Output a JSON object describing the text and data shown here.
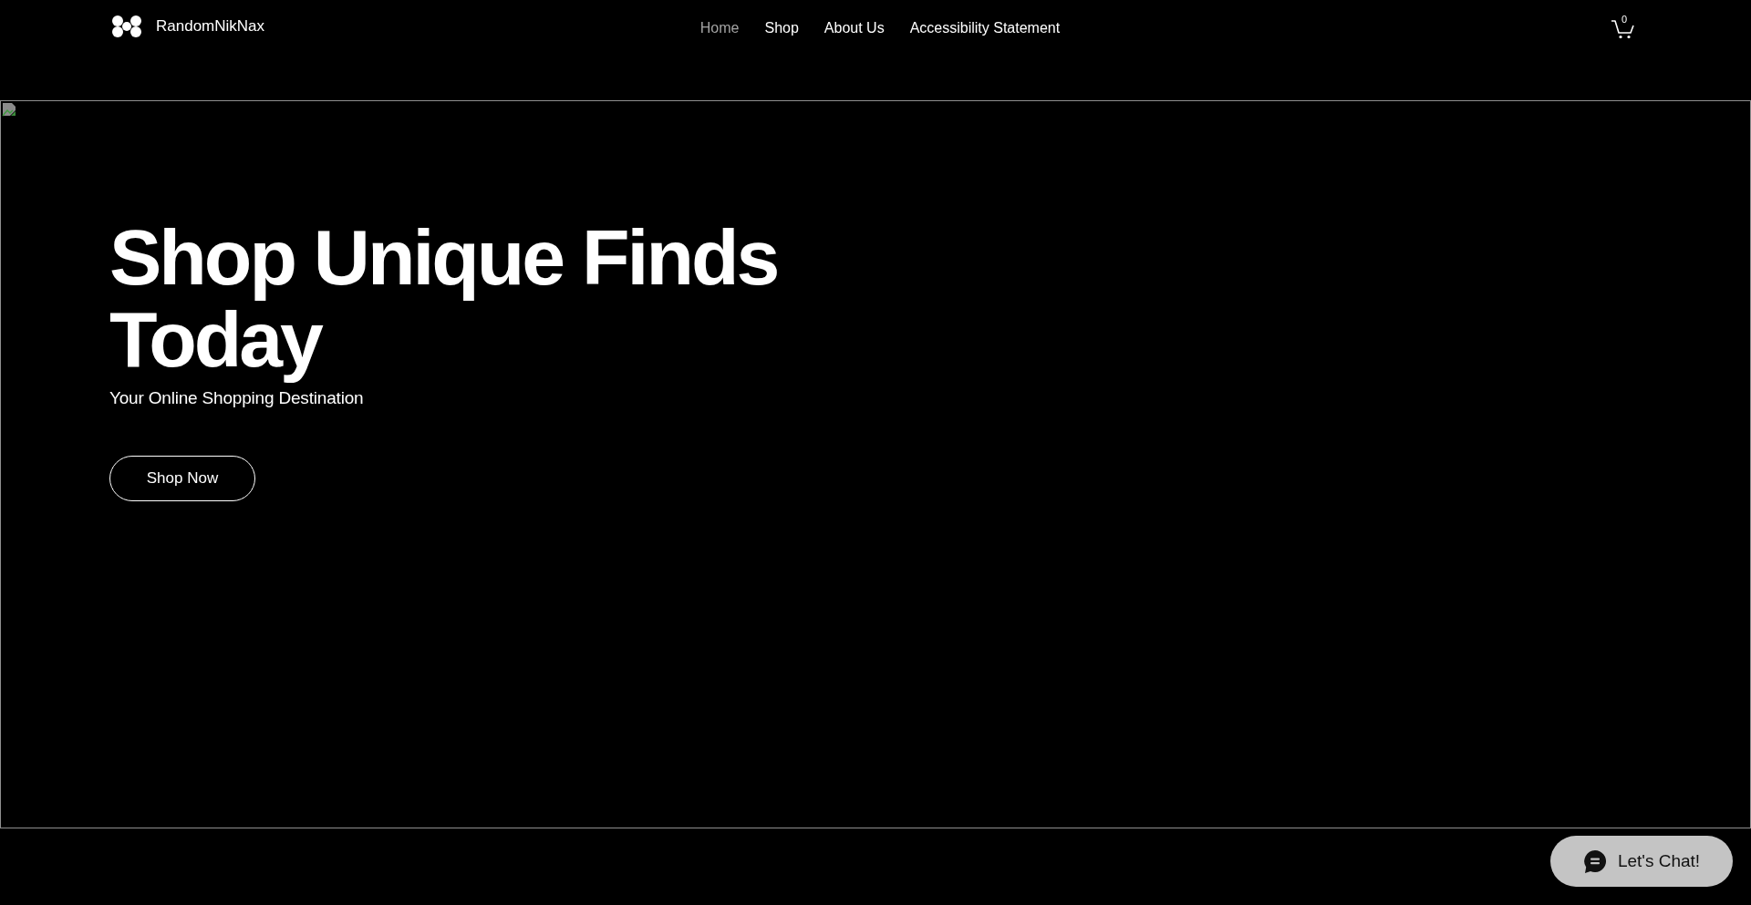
{
  "header": {
    "brand": "RandomNikNax",
    "nav": [
      {
        "label": "Home",
        "selected": true
      },
      {
        "label": "Shop",
        "selected": false
      },
      {
        "label": "About Us",
        "selected": false
      },
      {
        "label": "Accessibility Statement",
        "selected": false
      }
    ],
    "cart": {
      "count": "0"
    }
  },
  "hero": {
    "title": "Shop Unique Finds Today",
    "subtitle": "Your Online Shopping Destination",
    "button": "Shop Now"
  },
  "chat": {
    "label": "Let's Chat!"
  }
}
